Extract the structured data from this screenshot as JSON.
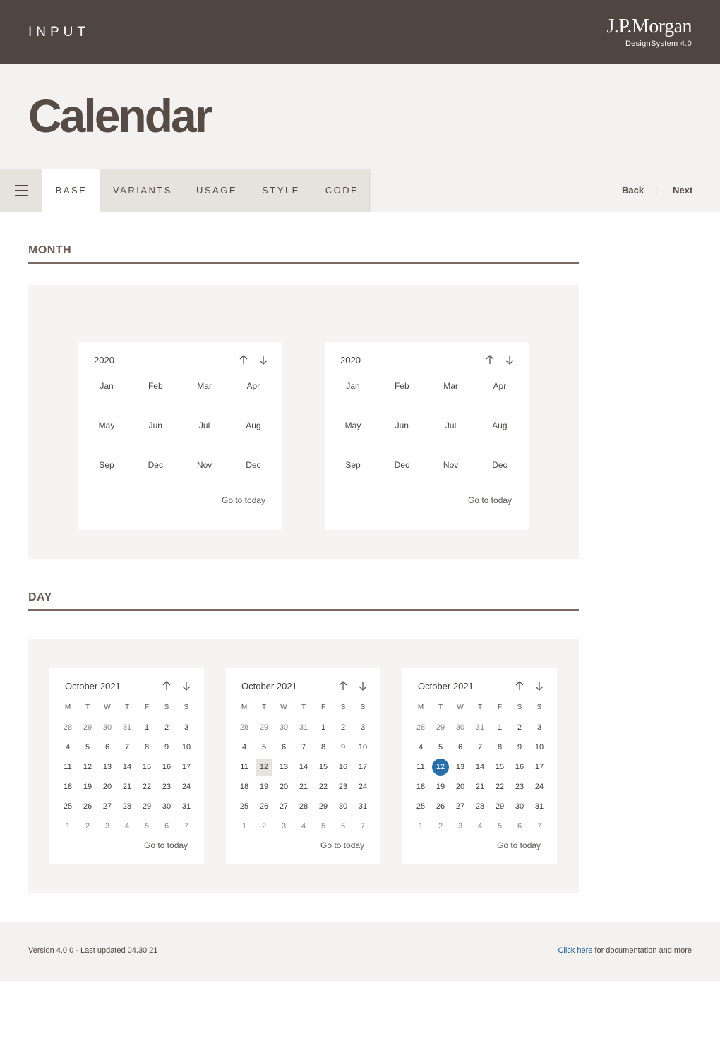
{
  "header": {
    "section": "INPUT",
    "brand": "J.P.Morgan",
    "brand_sub": "DesignSystem  4.0"
  },
  "page_title": "Calendar",
  "tabs": [
    {
      "label": "BASE",
      "active": true
    },
    {
      "label": "VARIANTS",
      "active": false
    },
    {
      "label": "USAGE",
      "active": false
    },
    {
      "label": "STYLE",
      "active": false
    },
    {
      "label": "CODE",
      "active": false
    }
  ],
  "pager": {
    "back": "Back",
    "separator": "|",
    "next": "Next"
  },
  "sections": {
    "month": "MONTH",
    "day": "DAY"
  },
  "month_pickers": [
    {
      "year": "2020",
      "months": [
        "Jan",
        "Feb",
        "Mar",
        "Apr",
        "May",
        "Jun",
        "Jul",
        "Aug",
        "Sep",
        "Dec",
        "Nov",
        "Dec"
      ],
      "goto": "Go to today"
    },
    {
      "year": "2020",
      "months": [
        "Jan",
        "Feb",
        "Mar",
        "Apr",
        "May",
        "Jun",
        "Jul",
        "Aug",
        "Sep",
        "Dec",
        "Nov",
        "Dec"
      ],
      "goto": "Go to today"
    }
  ],
  "day_pickers": [
    {
      "title": "October 2021",
      "state": "default",
      "goto": "Go to today"
    },
    {
      "title": "October 2021",
      "state": "hover",
      "goto": "Go to today"
    },
    {
      "title": "October 2021",
      "state": "selected",
      "goto": "Go to today"
    }
  ],
  "weekdays": [
    "M",
    "T",
    "W",
    "T",
    "F",
    "S",
    "S"
  ],
  "day_grid": [
    [
      "28",
      "29",
      "30",
      "31",
      "1",
      "2",
      "3"
    ],
    [
      "4",
      "5",
      "6",
      "7",
      "8",
      "9",
      "10"
    ],
    [
      "11",
      "12",
      "13",
      "14",
      "15",
      "16",
      "17"
    ],
    [
      "18",
      "19",
      "20",
      "21",
      "22",
      "23",
      "24"
    ],
    [
      "25",
      "26",
      "27",
      "28",
      "29",
      "30",
      "31"
    ],
    [
      "1",
      "2",
      "3",
      "4",
      "5",
      "6",
      "7"
    ]
  ],
  "highlighted_day": "12",
  "icons": {
    "menu": "hamburger-icon",
    "prev": "arrow-up-icon",
    "next": "arrow-down-icon"
  },
  "colors": {
    "header_bg": "#4f4541",
    "selected": "#2a6ea6",
    "hover": "#e6e3df",
    "link": "#1f5f94"
  },
  "footer": {
    "version": "Version 4.0.0 - Last updated 04.30.21",
    "link": "Click here",
    "link_suffix": " for documentation and more"
  }
}
